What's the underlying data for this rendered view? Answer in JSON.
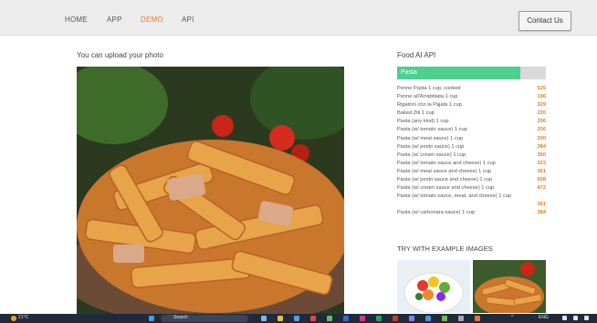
{
  "nav": {
    "items": [
      "HOME",
      "APP",
      "DEMO",
      "API"
    ],
    "active": "DEMO",
    "contact_label": "Contact Us"
  },
  "upload": {
    "title": "You can upload your photo"
  },
  "api": {
    "title": "Food AI API",
    "query": "Pasta",
    "query_fill": 0.83
  },
  "foods": [
    {
      "name": "Penne Pasta 1 cup, cooked",
      "cal": "525"
    },
    {
      "name": "Penne all'Arrabbiata 1 cup",
      "cal": "196"
    },
    {
      "name": "Rigatoni con la Pajata 1 cup",
      "cal": "329"
    },
    {
      "name": "Baked Ziti 1 cup",
      "cal": "220"
    },
    {
      "name": "Pasta (any kind) 1 cup",
      "cal": "206"
    },
    {
      "name": "Pasta (w/ tomato sauce) 1 cup",
      "cal": "206"
    },
    {
      "name": "Pasta (w/ meat sauce) 1 cup",
      "cal": "200"
    },
    {
      "name": "Pasta (w/ pesto sauce) 1 cup",
      "cal": "384"
    },
    {
      "name": "Pasta (w/ cream sauce) 1 cup",
      "cal": "350"
    },
    {
      "name": "Pasta (w/ tomato sauce and cheese) 1 cup",
      "cal": "223"
    },
    {
      "name": "Pasta (w/ meat sauce and cheese) 1 cup",
      "cal": "361"
    },
    {
      "name": "Pasta (w/ pesto sauce and cheese) 1 cup",
      "cal": "608"
    },
    {
      "name": "Pasta (w/ cream sauce and cheese) 1 cup",
      "cal": "472"
    },
    {
      "name": "Pasta (w/ tomato sauce, meat, and cheese) 1 cup",
      "cal": ""
    },
    {
      "name": "",
      "cal": "361"
    },
    {
      "name": "Pasta (w/ carbonara sauce) 1 cup",
      "cal": "384"
    }
  ],
  "examples": {
    "title": "TRY WITH EXAMPLE IMAGES"
  },
  "taskbar": {
    "weather": "21°C",
    "search": "Search",
    "lang": "ENG"
  },
  "colors": {
    "accent": "#e67e22",
    "query_bar": "#4cd08d",
    "taskbar": "#1f2a3a"
  }
}
